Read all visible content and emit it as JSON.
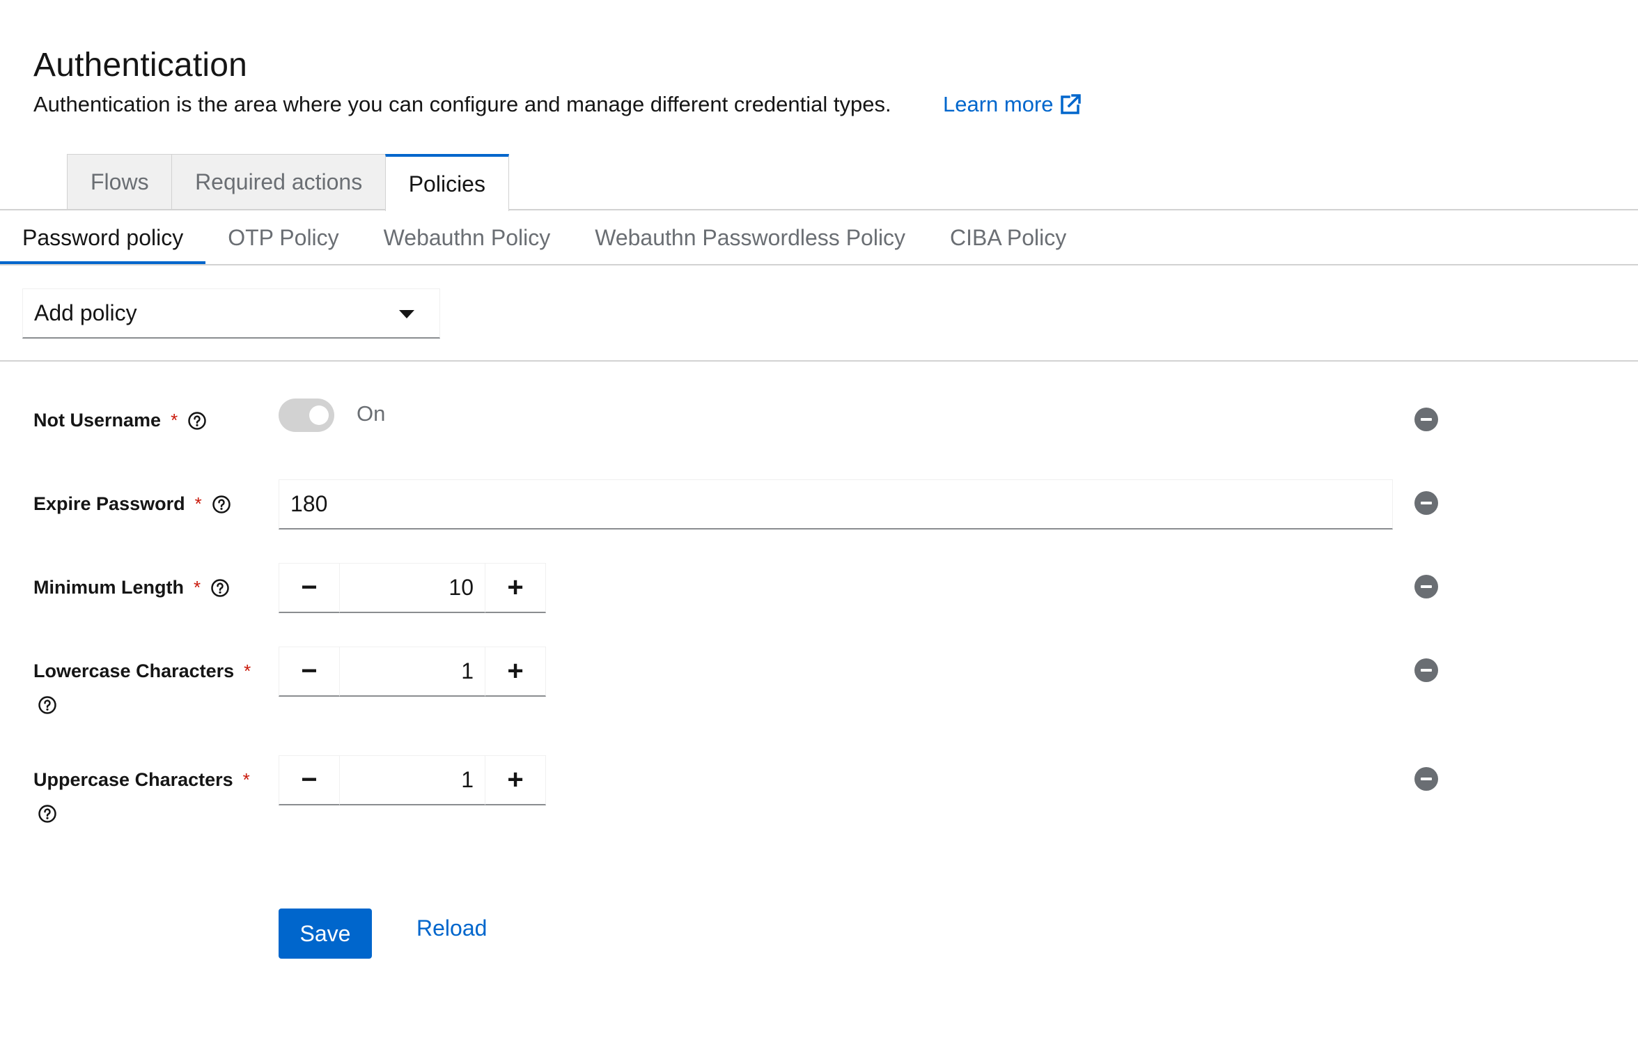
{
  "header": {
    "title": "Authentication",
    "description": "Authentication is the area where you can configure and manage different credential types.",
    "learn_more": "Learn more"
  },
  "tabs": [
    {
      "label": "Flows",
      "active": false
    },
    {
      "label": "Required actions",
      "active": false
    },
    {
      "label": "Policies",
      "active": true
    }
  ],
  "policy_tabs": [
    {
      "label": "Password policy",
      "active": true
    },
    {
      "label": "OTP Policy",
      "active": false
    },
    {
      "label": "Webauthn Policy",
      "active": false
    },
    {
      "label": "Webauthn Passwordless Policy",
      "active": false
    },
    {
      "label": "CIBA Policy",
      "active": false
    }
  ],
  "add_policy": {
    "label": "Add policy"
  },
  "policies": {
    "not_username": {
      "label": "Not Username",
      "required_mark": "*",
      "toggle_label": "On",
      "enabled": true
    },
    "expire_password": {
      "label": "Expire Password",
      "required_mark": "*",
      "value": "180"
    },
    "minimum_length": {
      "label": "Minimum Length",
      "required_mark": "*",
      "value": "10",
      "minus": "−",
      "plus": "+"
    },
    "lowercase": {
      "label": "Lowercase Characters",
      "required_mark": "*",
      "value": "1",
      "minus": "−",
      "plus": "+"
    },
    "uppercase": {
      "label": "Uppercase Characters",
      "required_mark": "*",
      "value": "1",
      "minus": "−",
      "plus": "+"
    }
  },
  "actions": {
    "save": "Save",
    "reload": "Reload"
  },
  "colors": {
    "accent": "#0066cc",
    "required": "#c9190b",
    "muted": "#6a6e73"
  },
  "icons": [
    "external-link-icon",
    "help-icon",
    "caret-down-icon",
    "minus-circle-icon",
    "toggle-switch"
  ]
}
